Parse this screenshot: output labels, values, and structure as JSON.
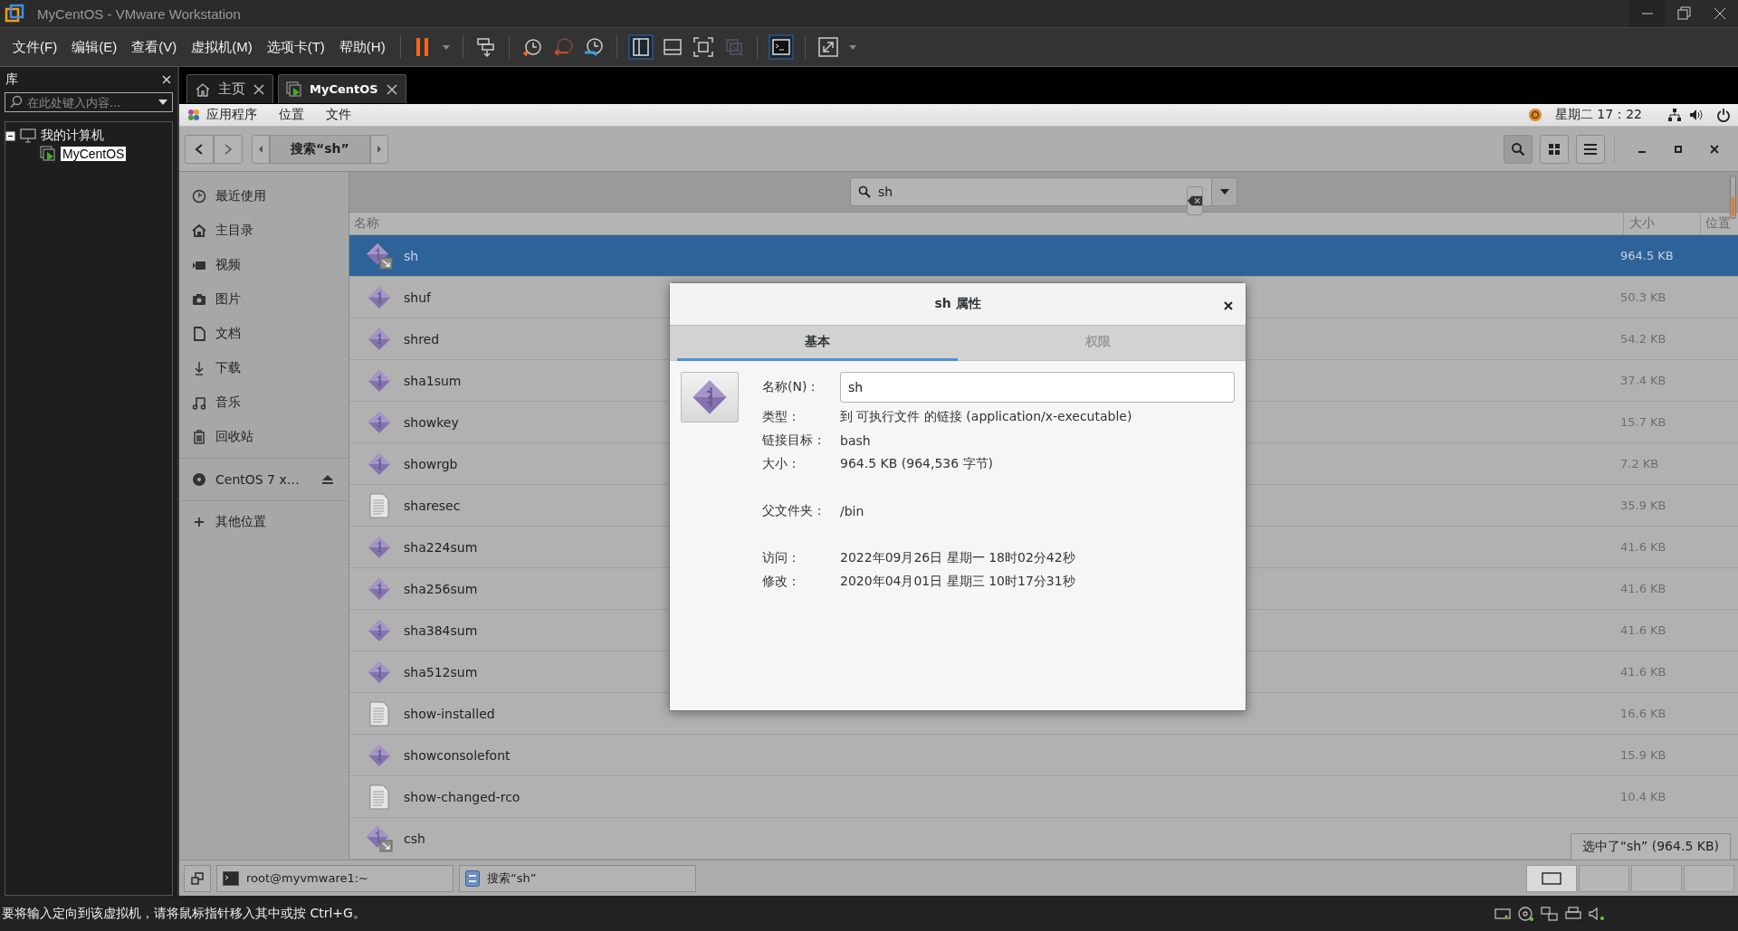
{
  "window": {
    "title": "MyCentOS - VMware Workstation"
  },
  "menu": [
    "文件(F)",
    "编辑(E)",
    "查看(V)",
    "虚拟机(M)",
    "选项卡(T)",
    "帮助(H)"
  ],
  "library": {
    "title": "库",
    "search": {
      "placeholder": "在此处键入内容..."
    },
    "tree": [
      {
        "label": "我的计算机",
        "expanded": true,
        "selected": false,
        "children": [
          {
            "label": "MyCentOS",
            "selected": true
          }
        ]
      }
    ]
  },
  "tabs": [
    {
      "label": "主页",
      "selected": false
    },
    {
      "label": "MyCentOS",
      "selected": true
    }
  ],
  "guest": {
    "topbar": {
      "menus": [
        "应用程序",
        "位置",
        "文件"
      ],
      "clock": "星期二 17：22"
    },
    "files": {
      "path": "搜索“sh”",
      "search": {
        "value": "sh"
      },
      "sidebar": [
        {
          "label": "最近使用",
          "kind": "recent"
        },
        {
          "label": "主目录",
          "kind": "home"
        },
        {
          "label": "视频",
          "kind": "video"
        },
        {
          "label": "图片",
          "kind": "pictures"
        },
        {
          "label": "文档",
          "kind": "documents"
        },
        {
          "label": "下载",
          "kind": "downloads"
        },
        {
          "label": "音乐",
          "kind": "music"
        },
        {
          "label": "回收站",
          "kind": "trash"
        },
        {
          "label": "CentOS 7 x…",
          "kind": "disc"
        },
        {
          "label": "其他位置",
          "kind": "other"
        }
      ],
      "columns": [
        "名称",
        "大小",
        "位置"
      ],
      "rows": [
        {
          "name": "sh",
          "size": "964.5 KB",
          "kind": "link",
          "selected": true
        },
        {
          "name": "shuf",
          "size": "50.3 KB",
          "kind": "executable",
          "selected": false
        },
        {
          "name": "shred",
          "size": "54.2 KB",
          "kind": "executable",
          "selected": false
        },
        {
          "name": "sha1sum",
          "size": "37.4 KB",
          "kind": "executable",
          "selected": false
        },
        {
          "name": "showkey",
          "size": "15.7 KB",
          "kind": "executable",
          "selected": false
        },
        {
          "name": "showrgb",
          "size": "7.2 KB",
          "kind": "executable",
          "selected": false
        },
        {
          "name": "sharesec",
          "size": "35.9 KB",
          "kind": "text",
          "selected": false
        },
        {
          "name": "sha224sum",
          "size": "41.6 KB",
          "kind": "executable",
          "selected": false
        },
        {
          "name": "sha256sum",
          "size": "41.6 KB",
          "kind": "executable",
          "selected": false
        },
        {
          "name": "sha384sum",
          "size": "41.6 KB",
          "kind": "executable",
          "selected": false
        },
        {
          "name": "sha512sum",
          "size": "41.6 KB",
          "kind": "executable",
          "selected": false
        },
        {
          "name": "show-installed",
          "size": "16.6 KB",
          "kind": "text",
          "selected": false
        },
        {
          "name": "showconsolefont",
          "size": "15.9 KB",
          "kind": "executable",
          "selected": false
        },
        {
          "name": "show-changed-rco",
          "size": "10.4 KB",
          "kind": "text",
          "selected": false
        },
        {
          "name": "csh",
          "kind": "link",
          "selected": false
        }
      ],
      "status": "选中了“sh” (964.5 KB)"
    },
    "dialog": {
      "title": "sh 属性",
      "tabs": [
        {
          "label": "基本",
          "selected": true
        },
        {
          "label": "权限",
          "selected": false
        }
      ],
      "name_field": {
        "label": "名称(N)：",
        "value": "sh"
      },
      "groups": [
        [
          {
            "label": "类型：",
            "value": "到 可执行文件 的链接 (application/x-executable)"
          },
          {
            "label": "链接目标：",
            "value": "bash"
          },
          {
            "label": "大小：",
            "value": "964.5 KB (964,536 字节)"
          }
        ],
        [
          {
            "label": "父文件夹：",
            "value": "/bin"
          }
        ],
        [
          {
            "label": "访问：",
            "value": "2022年09月26日 星期一 18时02分42秒"
          },
          {
            "label": "修改：",
            "value": "2020年04月01日 星期三 10时17分31秒"
          }
        ]
      ]
    },
    "taskbar": {
      "windows": [
        {
          "label": "root@myvmware1:~",
          "kind": "terminal"
        },
        {
          "label": "搜索“sh”",
          "kind": "files"
        }
      ]
    }
  },
  "status_bar": "要将输入定向到该虚拟机，请将鼠标指针移入其中或按 Ctrl+G。"
}
